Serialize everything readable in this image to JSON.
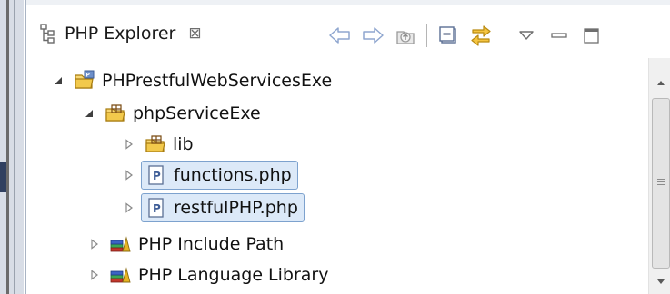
{
  "view": {
    "tab_label": "PHP Explorer",
    "tab_close_glyph": "⊠"
  },
  "toolbar": {
    "icons": [
      "back-arrow-icon",
      "forward-arrow-icon",
      "up-folder-icon",
      "collapse-all-icon",
      "link-with-editor-icon",
      "view-menu-icon",
      "minimize-icon",
      "maximize-icon"
    ]
  },
  "tree": {
    "project": "PHPrestfulWebServicesExe",
    "folder": "phpServiceExe",
    "lib": "lib",
    "file1": "functions.php",
    "file2": "restfulPHP.php",
    "include_path": "PHP Include Path",
    "language_library": "PHP Language Library"
  },
  "colors": {
    "selection_bg": "#dce9f8",
    "selection_border": "#7da2ce",
    "arrow_blue": "#6d8fc9",
    "folder_yellow": "#f2c94c"
  }
}
